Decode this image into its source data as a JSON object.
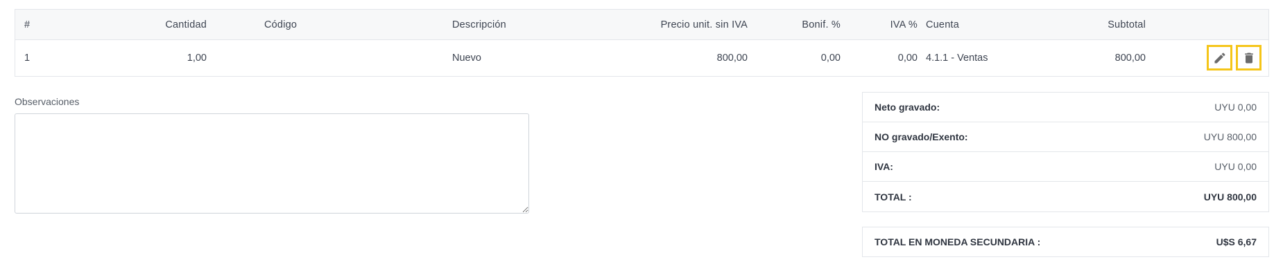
{
  "items_table": {
    "headers": {
      "num": "#",
      "cantidad": "Cantidad",
      "codigo": "Código",
      "descripcion": "Descripción",
      "precio": "Precio unit. sin IVA",
      "bonif": "Bonif. %",
      "iva": "IVA %",
      "cuenta": "Cuenta",
      "subtotal": "Subtotal"
    },
    "rows": [
      {
        "num": "1",
        "cantidad": "1,00",
        "codigo": "",
        "descripcion": "Nuevo",
        "precio": "800,00",
        "bonif": "0,00",
        "iva": "0,00",
        "cuenta": "4.1.1 - Ventas",
        "subtotal": "800,00",
        "actions": [
          "edit-pencil-icon",
          "delete-trash-icon"
        ]
      }
    ]
  },
  "observaciones": {
    "label": "Observaciones",
    "value": ""
  },
  "totals": {
    "neto_label": "Neto gravado:",
    "neto_value": "UYU 0,00",
    "no_gravado_label": "NO gravado/Exento:",
    "no_gravado_value": "UYU 800,00",
    "iva_label": "IVA:",
    "iva_value": "UYU 0,00",
    "total_label": "TOTAL :",
    "total_value": "UYU 800,00"
  },
  "secondary_total": {
    "label": "TOTAL EN MONEDA SECUNDARIA :",
    "value": "U$S 6,67"
  },
  "colors": {
    "highlight": "#f5c518",
    "border": "#e3e6ea",
    "text": "#3d4451"
  }
}
